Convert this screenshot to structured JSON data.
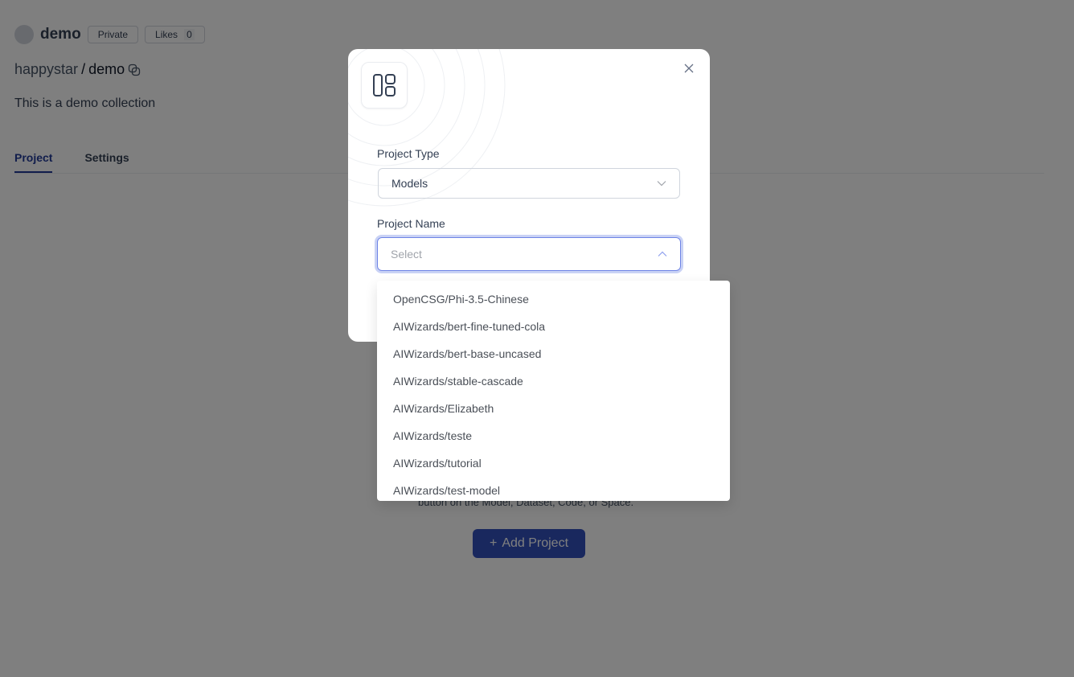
{
  "header": {
    "title": "demo",
    "private_badge": "Private",
    "likes_label": "Likes",
    "likes_count": "0"
  },
  "path": {
    "owner": "happystar",
    "separator": " / ",
    "name": "demo"
  },
  "description": "This is a demo collection",
  "tabs": [
    {
      "label": "Project",
      "active": true
    },
    {
      "label": "Settings",
      "active": false
    }
  ],
  "empty_state": {
    "hint": "button on the Model, Dataset, Code, or Space.",
    "add_button": "Add Project"
  },
  "modal": {
    "icon": "layout-icon",
    "project_type_label": "Project Type",
    "project_type_value": "Models",
    "project_name_label": "Project Name",
    "project_name_placeholder": "Select",
    "options": [
      "OpenCSG/Phi-3.5-Chinese",
      "AIWizards/bert-fine-tuned-cola",
      "AIWizards/bert-base-uncased",
      "AIWizards/stable-cascade",
      "AIWizards/Elizabeth",
      "AIWizards/teste",
      "AIWizards/tutorial",
      "AIWizards/test-model"
    ]
  },
  "colors": {
    "accent": "#223b99",
    "button": "#3250bd",
    "focus": "#6d83e6"
  }
}
